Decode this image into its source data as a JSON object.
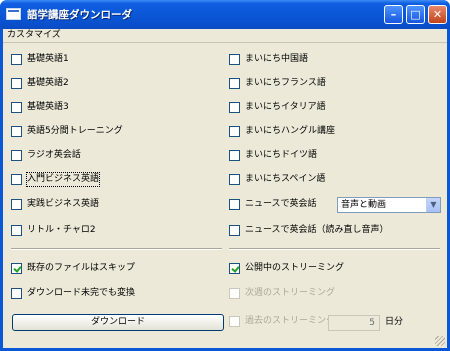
{
  "window": {
    "title": "語学講座ダウンローダ"
  },
  "menu": {
    "items": [
      "カスタマイズ"
    ]
  },
  "courses_left": [
    {
      "label": "基礎英語1",
      "checked": false
    },
    {
      "label": "基礎英語2",
      "checked": false
    },
    {
      "label": "基礎英語3",
      "checked": false
    },
    {
      "label": "英語5分間トレーニング",
      "checked": false
    },
    {
      "label": "ラジオ英会話",
      "checked": false
    },
    {
      "label": "入門ビジネス英語",
      "checked": false
    },
    {
      "label": "実践ビジネス英語",
      "checked": false
    },
    {
      "label": "リトル・チャロ2",
      "checked": false
    }
  ],
  "courses_right": [
    {
      "label": "まいにち中国語",
      "checked": false
    },
    {
      "label": "まいにちフランス語",
      "checked": false
    },
    {
      "label": "まいにちイタリア語",
      "checked": false
    },
    {
      "label": "まいにちハングル講座",
      "checked": false
    },
    {
      "label": "まいにちドイツ語",
      "checked": false
    },
    {
      "label": "まいにちスペイン語",
      "checked": false
    },
    {
      "label": "ニュースで英会話",
      "checked": false
    },
    {
      "label": "ニュースで英会話（読み直し音声）",
      "checked": false
    }
  ],
  "news_format": {
    "selected": "音声と動画"
  },
  "options": {
    "skip_existing": {
      "label": "既存のファイルはスキップ",
      "checked": true
    },
    "convert_incomplete": {
      "label": "ダウンロード未完でも変換",
      "checked": false
    },
    "public_streaming": {
      "label": "公開中のストリーミング",
      "checked": true
    },
    "next_week_streaming": {
      "label": "次週のストリーミング",
      "checked": false,
      "disabled": true
    },
    "past_streaming": {
      "label": "過去のストリーミング",
      "checked": false,
      "disabled": true
    }
  },
  "download_button": "ダウンロード",
  "past_days": {
    "value": "5",
    "unit": "日分"
  }
}
